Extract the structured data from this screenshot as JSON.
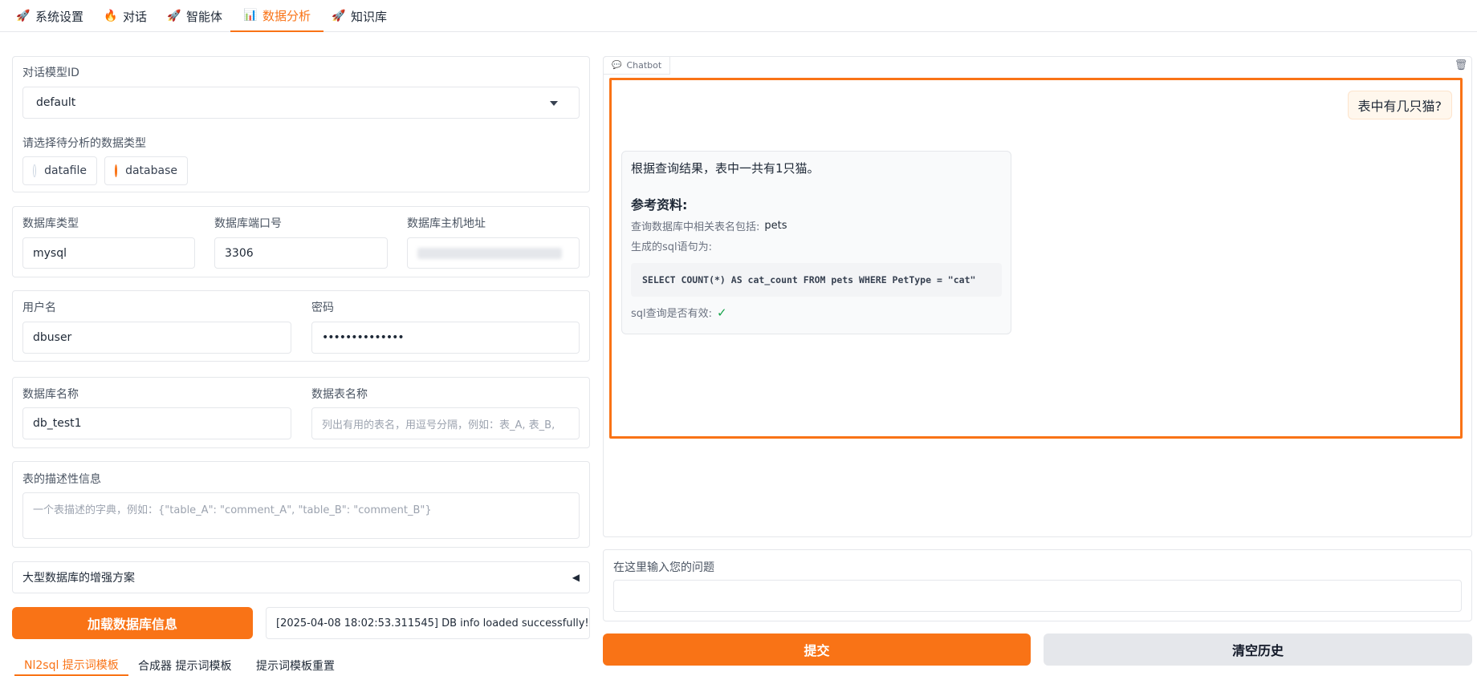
{
  "tabs": [
    {
      "icon": "🚀",
      "label": "系统设置"
    },
    {
      "icon": "🔥",
      "label": "对话"
    },
    {
      "icon": "🚀",
      "label": "智能体"
    },
    {
      "icon": "📊",
      "label": "数据分析"
    },
    {
      "icon": "🚀",
      "label": "知识库"
    }
  ],
  "model": {
    "label": "对话模型ID",
    "value": "default"
  },
  "data_type": {
    "label": "请选择待分析的数据类型",
    "options": [
      "datafile",
      "database"
    ],
    "selected": "database"
  },
  "db": {
    "type_label": "数据库类型",
    "type_value": "mysql",
    "port_label": "数据库端口号",
    "port_value": "3306",
    "host_label": "数据库主机地址",
    "user_label": "用户名",
    "user_value": "dbuser",
    "pwd_label": "密码",
    "pwd_value": "••••••••••••••",
    "name_label": "数据库名称",
    "name_value": "db_test1",
    "table_label": "数据表名称",
    "table_placeholder": "列出有用的表名，用逗号分隔，例如：表_A, 表_B,",
    "desc_label": "表的描述性信息",
    "desc_placeholder": "一个表描述的字典，例如：{\"table_A\": \"comment_A\", \"table_B\": \"comment_B\"}"
  },
  "enhance": {
    "label": "大型数据库的增强方案",
    "arrow": "◀"
  },
  "load_button": "加载数据库信息",
  "log": "[2025-04-08 18:02:53.311545] DB info loaded successfully!",
  "bottom_tabs": [
    "Nl2sql 提示词模板",
    "合成器 提示词模板",
    "提示词模板重置"
  ],
  "chatbot": {
    "tag": "Chatbot",
    "user_msg": "表中有几只猫?",
    "answer": "根据查询结果，表中一共有1只猫。",
    "ref_title": "参考资料:",
    "tables_label": "查询数据库中相关表名包括:",
    "tables_value": "pets",
    "sql_label": "生成的sql语句为:",
    "sql": "SELECT COUNT(*) AS cat_count FROM pets WHERE PetType = \"cat\"",
    "valid_label": "sql查询是否有效:",
    "valid_mark": "✓"
  },
  "question": {
    "label": "在这里输入您的问题"
  },
  "submit_button": "提交",
  "clear_button": "清空历史",
  "colors": {
    "accent": "#f97316"
  }
}
